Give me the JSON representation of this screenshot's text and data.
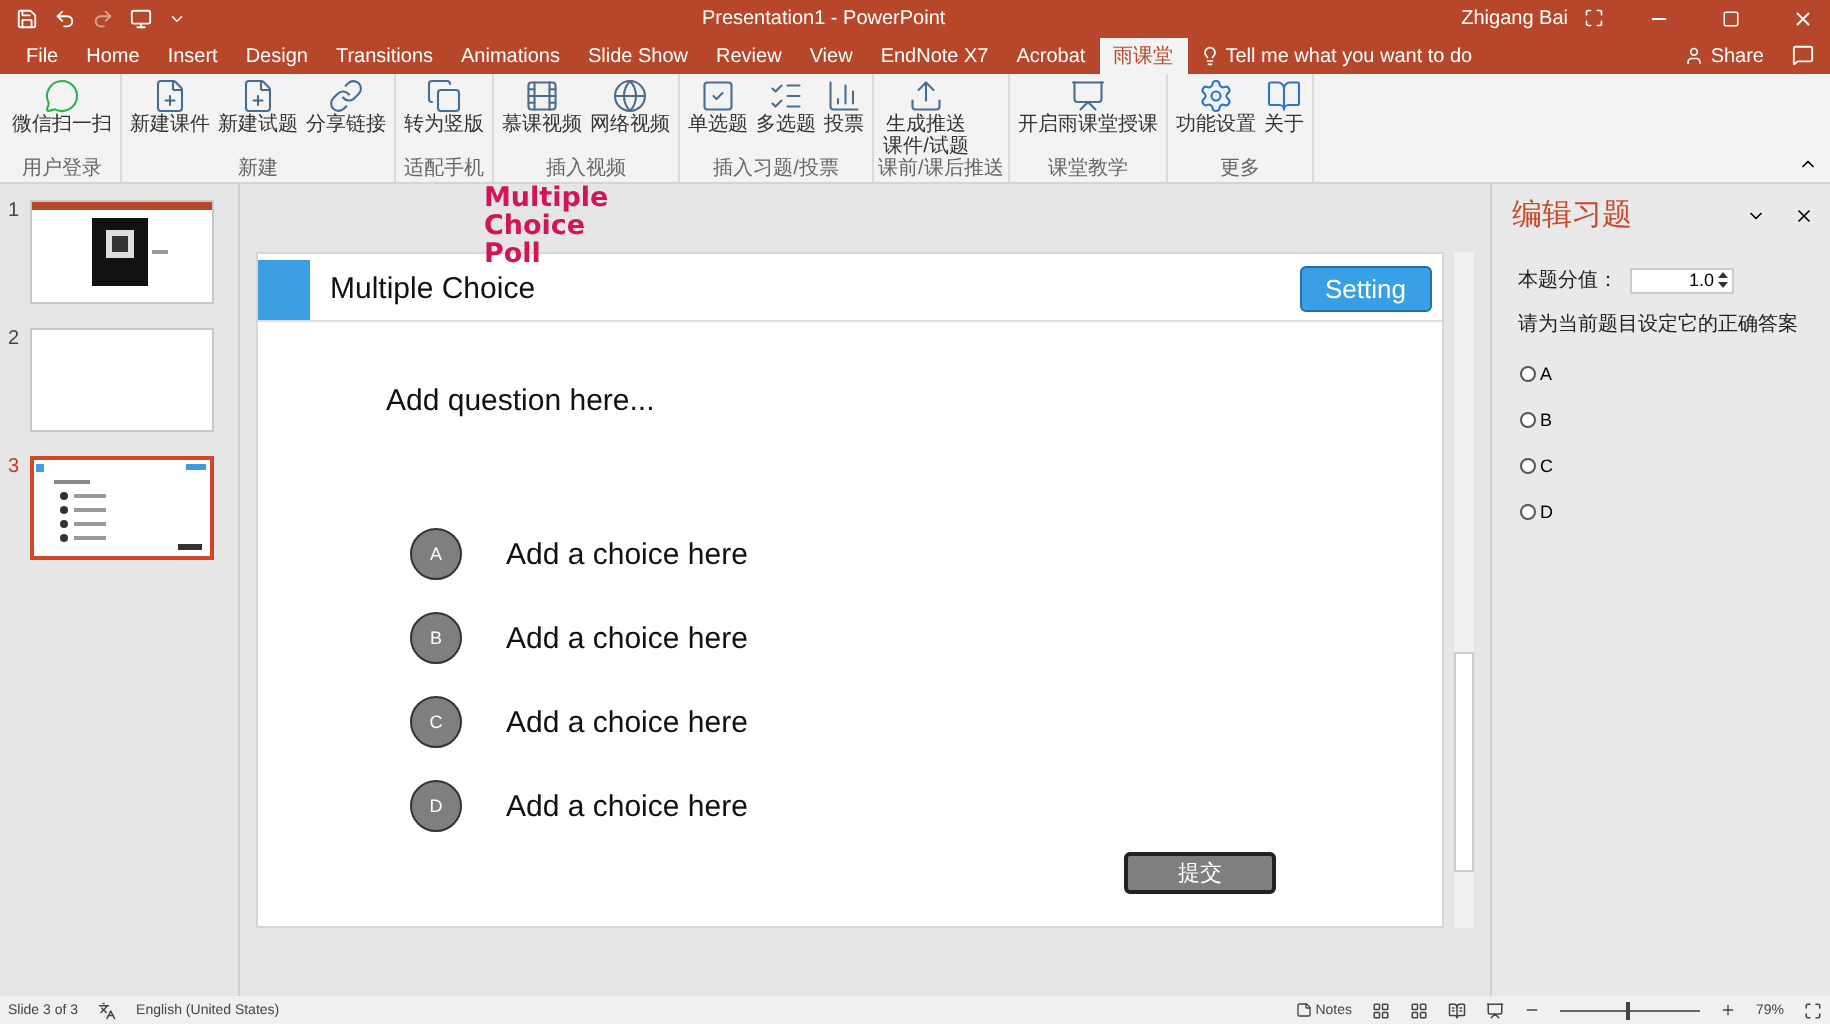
{
  "window": {
    "title": "Presentation1  -  PowerPoint",
    "user": "Zhigang Bai"
  },
  "menu_tabs": [
    {
      "label": "File",
      "selected": false
    },
    {
      "label": "Home",
      "selected": false
    },
    {
      "label": "Insert",
      "selected": false
    },
    {
      "label": "Design",
      "selected": false
    },
    {
      "label": "Transitions",
      "selected": false
    },
    {
      "label": "Animations",
      "selected": false
    },
    {
      "label": "Slide Show",
      "selected": false
    },
    {
      "label": "Review",
      "selected": false
    },
    {
      "label": "View",
      "selected": false
    },
    {
      "label": "EndNote X7",
      "selected": false
    },
    {
      "label": "Acrobat",
      "selected": false
    },
    {
      "label": "雨课堂",
      "selected": true
    }
  ],
  "tell_me": {
    "placeholder": "Tell me what you want to do"
  },
  "share": "Share",
  "ribbon_groups": [
    {
      "label": "用户登录",
      "buttons": [
        {
          "label": "微信扫一扫"
        }
      ]
    },
    {
      "label": "新建",
      "buttons": [
        {
          "label": "新建课件"
        },
        {
          "label": "新建试题"
        },
        {
          "label": "分享链接"
        }
      ]
    },
    {
      "label": "适配手机",
      "buttons": [
        {
          "label": "转为竖版"
        }
      ]
    },
    {
      "label": "插入视频",
      "buttons": [
        {
          "label": "慕课视频"
        },
        {
          "label": "网络视频"
        }
      ]
    },
    {
      "label": "插入习题/投票",
      "buttons": [
        {
          "label": "单选题"
        },
        {
          "label": "多选题"
        },
        {
          "label": "投票"
        }
      ]
    },
    {
      "label": "课前/课后推送",
      "buttons": [
        {
          "label": "生成推送课件/试题"
        }
      ]
    },
    {
      "label": "课堂教学",
      "buttons": [
        {
          "label": "开启雨课堂授课"
        }
      ]
    },
    {
      "label": "更多",
      "buttons": [
        {
          "label": "功能设置"
        },
        {
          "label": "关于"
        }
      ]
    }
  ],
  "overlay": {
    "text": "Multiple Choice Poll"
  },
  "slides": [
    {
      "number": "1",
      "kind": "qr",
      "selected": false
    },
    {
      "number": "2",
      "kind": "blank",
      "selected": false
    },
    {
      "number": "3",
      "kind": "quiz",
      "selected": true
    }
  ],
  "slide": {
    "title": "Multiple Choice",
    "setting": "Setting",
    "question": "Add question here...",
    "choices": [
      {
        "letter": "A",
        "text": "Add a choice here"
      },
      {
        "letter": "B",
        "text": "Add a choice here"
      },
      {
        "letter": "C",
        "text": "Add a choice here"
      },
      {
        "letter": "D",
        "text": "Add a choice here"
      }
    ],
    "submit": "提交"
  },
  "pane": {
    "title": "编辑习题",
    "score_label": "本题分值：",
    "score": "1.0",
    "instruction": "请为当前题目设定它的正确答案",
    "options": [
      {
        "label": "A",
        "selected": false
      },
      {
        "label": "B",
        "selected": false
      },
      {
        "label": "C",
        "selected": false
      },
      {
        "label": "D",
        "selected": false
      }
    ]
  },
  "status": {
    "slide": "Slide 3 of 3",
    "language": "English (United States)",
    "notes": "Notes",
    "zoom": "79%",
    "zoom_slider": {
      "level": 0.48
    }
  }
}
